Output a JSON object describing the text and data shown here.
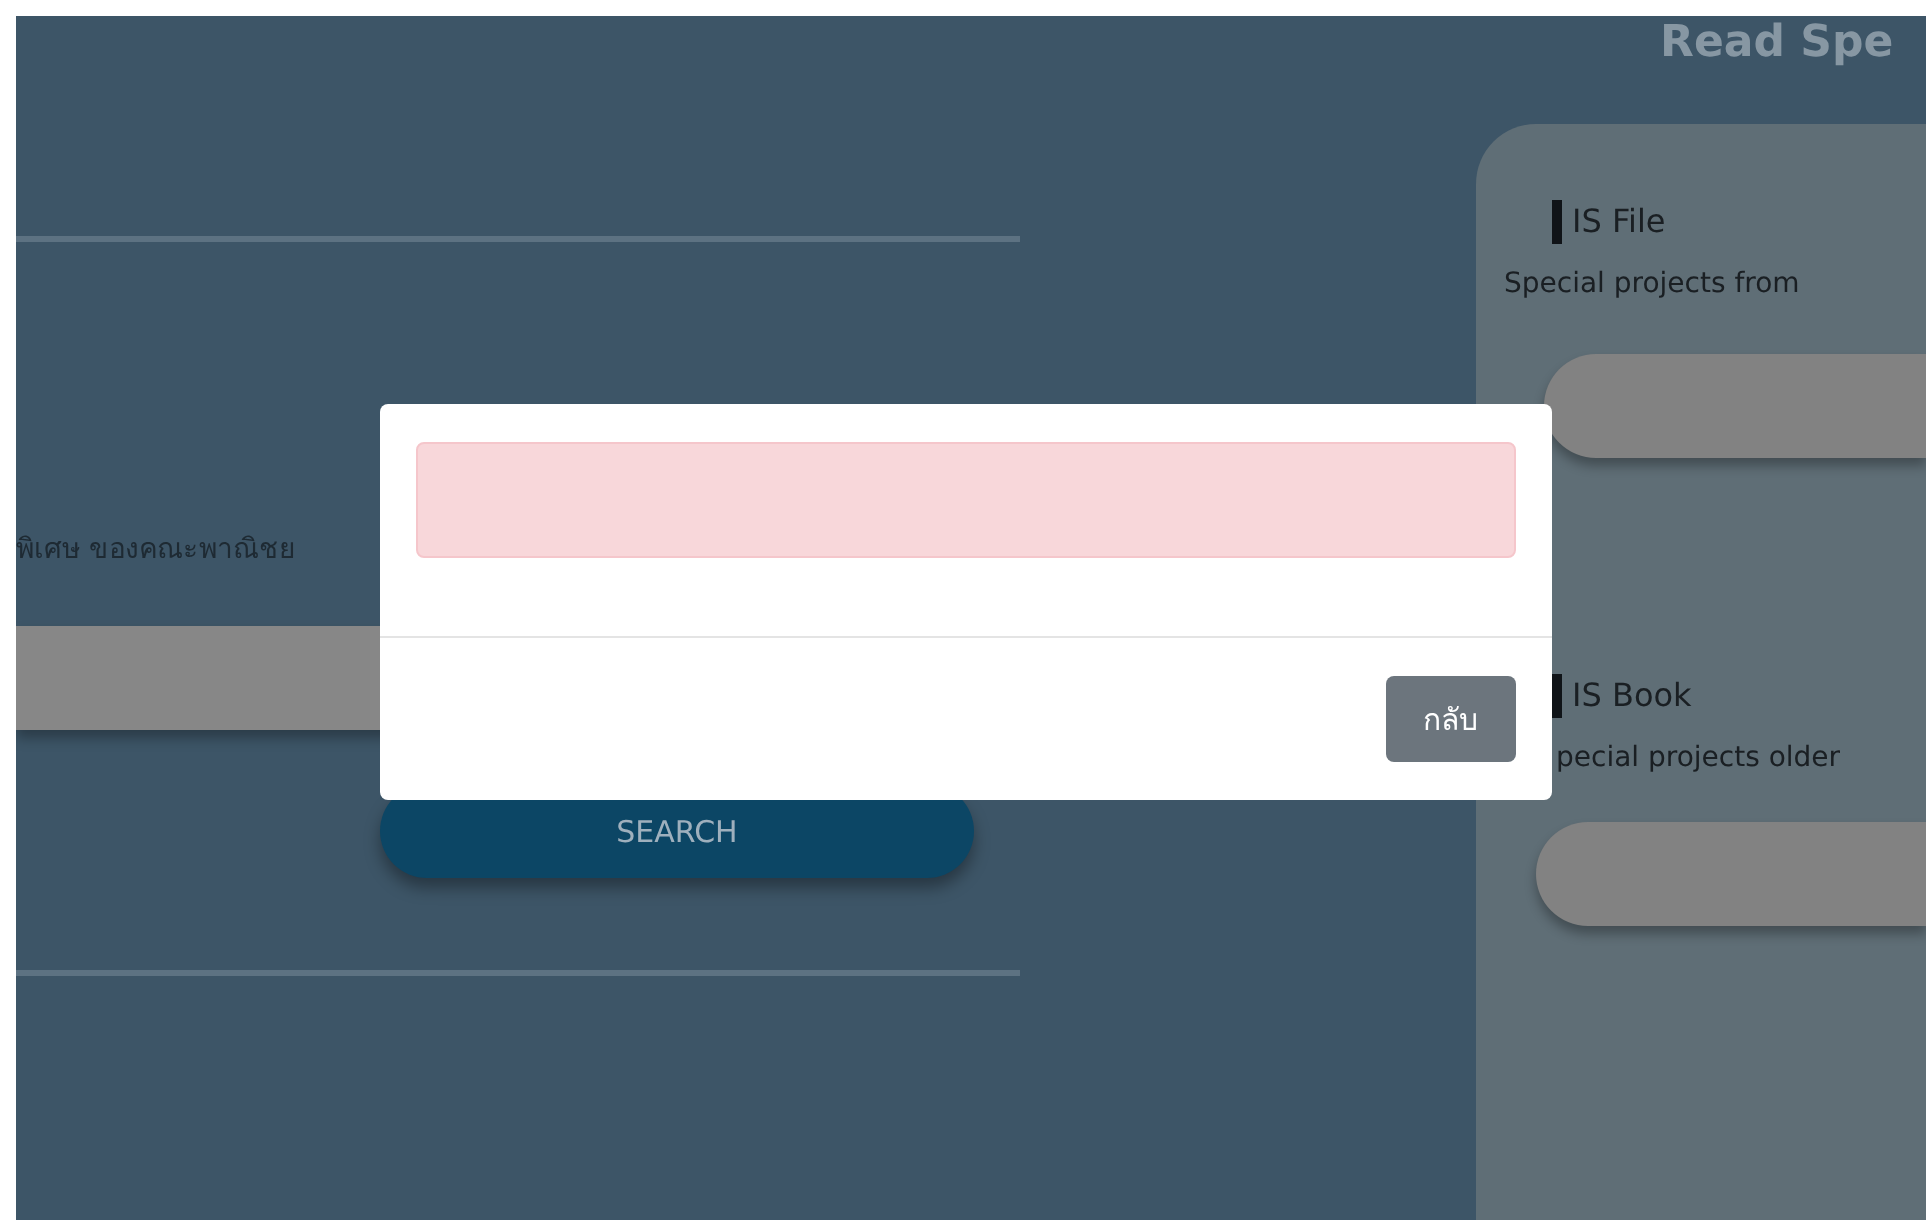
{
  "page": {
    "heading": "Read Spe",
    "intro_text": "พิเศษ ของคณะพาณิชย",
    "search_button": "SEARCH"
  },
  "cards": [
    {
      "title": "IS File",
      "description": "Special projects from"
    },
    {
      "title": "IS Book",
      "description": "pecial projects older"
    }
  ],
  "dialog": {
    "close_button": "กลับ"
  }
}
